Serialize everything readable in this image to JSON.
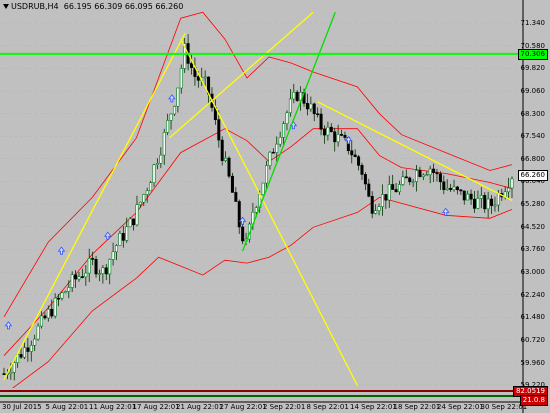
{
  "header": {
    "symbol": "USDRUB,H4",
    "ohlc": "66.195 66.309 66.095 66.260"
  },
  "colors": {
    "background": "#c0c0c0",
    "bands": "#ff0000",
    "trendline_yellow": "#ffff00",
    "trendline_green": "#00dd00",
    "horizontal_line": "#00ff00",
    "candle_up": "#007a20",
    "candle_down": "#000000",
    "wick": "#003300",
    "marker": "#3050ff"
  },
  "price_axis": {
    "labels": [
      "71.340",
      "70.580",
      "69.820",
      "69.060",
      "68.300",
      "67.540",
      "66.800",
      "66.040",
      "65.280",
      "64.520",
      "63.760",
      "63.000",
      "62.240",
      "61.480",
      "60.720",
      "59.960",
      "59.220"
    ],
    "current_price": "66.260",
    "horizontal_line_price": "70.306",
    "bottom_tags": [
      "82.0519",
      "21.0.8"
    ]
  },
  "time_axis": {
    "labels": [
      "30 Jul 2015",
      "5 Aug 22:01",
      "11 Aug 22:01",
      "17 Aug 22:01",
      "21 Aug 22:01",
      "27 Aug 22:01",
      "2 Sep 22:01",
      "8 Sep 22:01",
      "14 Sep 22:01",
      "18 Sep 22:01",
      "24 Sep 22:01",
      "30 Sep 22:01"
    ]
  },
  "chart_data": {
    "type": "candlestick",
    "symbol": "USDRUB",
    "timeframe": "H4",
    "ylim": [
      59.22,
      71.34
    ],
    "y_ticks": [
      71.34,
      70.58,
      69.82,
      69.06,
      68.3,
      67.54,
      66.8,
      66.04,
      65.28,
      64.52,
      63.76,
      63.0,
      62.24,
      61.48,
      60.72,
      59.96,
      59.22
    ],
    "x_categories": [
      "30 Jul 2015",
      "5 Aug 22:01",
      "11 Aug 22:01",
      "17 Aug 22:01",
      "21 Aug 22:01",
      "27 Aug 22:01",
      "2 Sep 22:01",
      "8 Sep 22:01",
      "14 Sep 22:01",
      "18 Sep 22:01",
      "24 Sep 22:01",
      "30 Sep 22:01"
    ],
    "close_path": [
      [
        0,
        59.6
      ],
      [
        1,
        60.5
      ],
      [
        2,
        61.6
      ],
      [
        3,
        62.6
      ],
      [
        4,
        63.3
      ],
      [
        4.5,
        63.0
      ],
      [
        5,
        63.8
      ],
      [
        5.8,
        64.7
      ],
      [
        6.5,
        65.9
      ],
      [
        7.2,
        67.4
      ],
      [
        7.8,
        69.0
      ],
      [
        8.2,
        70.5
      ],
      [
        8.6,
        69.6
      ],
      [
        9.2,
        69.2
      ],
      [
        9.8,
        67.2
      ],
      [
        10.3,
        65.8
      ],
      [
        10.7,
        64.4
      ],
      [
        11.0,
        63.8
      ],
      [
        11.2,
        64.9
      ],
      [
        11.7,
        66.0
      ],
      [
        12.3,
        67.4
      ],
      [
        12.9,
        68.5
      ],
      [
        13.3,
        69.0
      ],
      [
        13.8,
        68.6
      ],
      [
        14.3,
        67.9
      ],
      [
        14.9,
        67.6
      ],
      [
        15.6,
        67.2
      ],
      [
        16.2,
        66.4
      ],
      [
        16.6,
        65.2
      ],
      [
        17.3,
        65.6
      ],
      [
        18.0,
        65.9
      ],
      [
        18.7,
        66.4
      ],
      [
        19.3,
        66.5
      ],
      [
        19.9,
        65.9
      ],
      [
        20.6,
        65.6
      ],
      [
        21.3,
        65.4
      ],
      [
        22.0,
        65.2
      ],
      [
        22.5,
        65.7
      ],
      [
        23.0,
        66.26
      ]
    ],
    "markers": [
      [
        0.2,
        61.2
      ],
      [
        2.6,
        63.7
      ],
      [
        4.7,
        64.2
      ],
      [
        7.6,
        68.8
      ],
      [
        10.8,
        64.7
      ],
      [
        13.1,
        67.9
      ],
      [
        15.6,
        67.4
      ],
      [
        20.0,
        65.0
      ]
    ],
    "bollinger": {
      "upper": [
        [
          0,
          61.5
        ],
        [
          2,
          64.0
        ],
        [
          4,
          65.5
        ],
        [
          6,
          67.5
        ],
        [
          8,
          71.5
        ],
        [
          9,
          71.7
        ],
        [
          10,
          70.8
        ],
        [
          11,
          69.5
        ],
        [
          12,
          70.2
        ],
        [
          13,
          70.0
        ],
        [
          14,
          69.7
        ],
        [
          16,
          69.2
        ],
        [
          17,
          68.3
        ],
        [
          18,
          67.6
        ],
        [
          20,
          67.0
        ],
        [
          22,
          66.4
        ],
        [
          23,
          66.6
        ]
      ],
      "middle": [
        [
          0,
          60.2
        ],
        [
          2,
          61.8
        ],
        [
          4,
          63.6
        ],
        [
          6,
          65.0
        ],
        [
          8,
          67.0
        ],
        [
          10,
          67.8
        ],
        [
          11,
          67.4
        ],
        [
          12,
          66.7
        ],
        [
          13,
          67.2
        ],
        [
          14,
          67.8
        ],
        [
          16,
          67.8
        ],
        [
          17,
          66.9
        ],
        [
          18,
          66.5
        ],
        [
          20,
          66.3
        ],
        [
          22,
          66.0
        ],
        [
          23,
          65.8
        ]
      ],
      "lower": [
        [
          0,
          58.9
        ],
        [
          2,
          60.0
        ],
        [
          4,
          61.7
        ],
        [
          6,
          62.8
        ],
        [
          7,
          63.5
        ],
        [
          8,
          63.2
        ],
        [
          9,
          62.9
        ],
        [
          10,
          63.4
        ],
        [
          11,
          63.3
        ],
        [
          12,
          63.5
        ],
        [
          13,
          63.9
        ],
        [
          14,
          64.5
        ],
        [
          16,
          65.0
        ],
        [
          17,
          65.5
        ],
        [
          18,
          65.3
        ],
        [
          20,
          64.9
        ],
        [
          22,
          64.8
        ],
        [
          23,
          65.1
        ]
      ]
    },
    "trendlines": [
      {
        "color": "yellow",
        "from": [
          0,
          59.4
        ],
        "to": [
          8.2,
          71.0
        ]
      },
      {
        "color": "yellow",
        "from": [
          7.5,
          67.5
        ],
        "to": [
          14.0,
          71.7
        ]
      },
      {
        "color": "yellow",
        "from": [
          8.0,
          70.8
        ],
        "to": [
          16.0,
          59.2
        ]
      },
      {
        "color": "yellow",
        "from": [
          14.2,
          68.7
        ],
        "to": [
          23.0,
          65.4
        ]
      },
      {
        "color": "green",
        "from": [
          10.8,
          63.7
        ],
        "to": [
          15.0,
          71.7
        ]
      }
    ],
    "hline": 70.306
  }
}
